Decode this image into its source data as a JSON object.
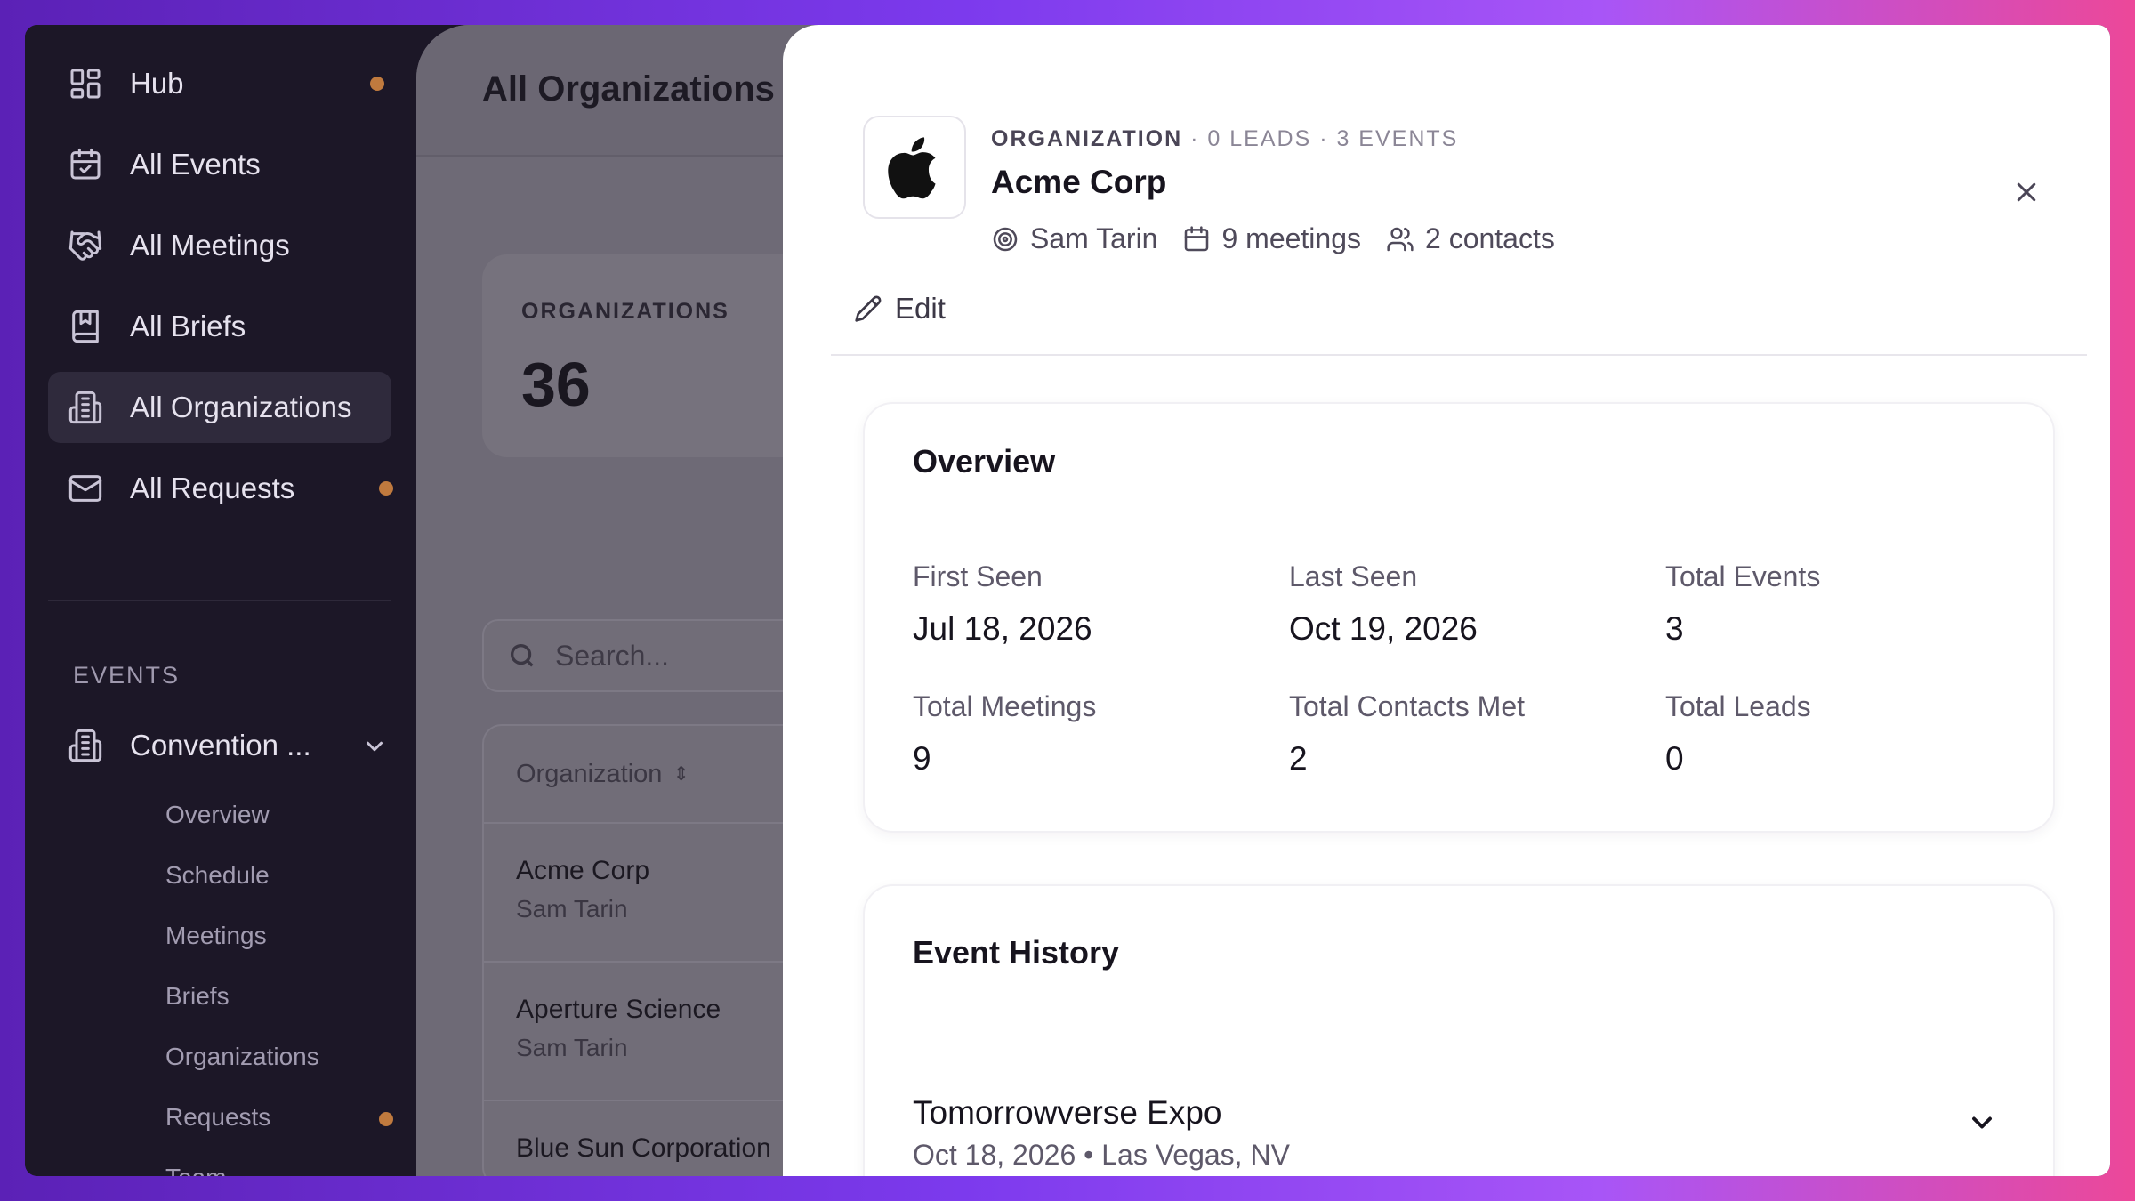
{
  "sidebar": {
    "items": [
      {
        "label": "Hub",
        "icon": "grid-icon",
        "has_dot": true
      },
      {
        "label": "All Events",
        "icon": "calendar-check-icon",
        "has_dot": false
      },
      {
        "label": "All Meetings",
        "icon": "handshake-icon",
        "has_dot": false
      },
      {
        "label": "All Briefs",
        "icon": "bookmark-book-icon",
        "has_dot": false
      },
      {
        "label": "All Organizations",
        "icon": "building-icon",
        "has_dot": false,
        "active": true
      },
      {
        "label": "All Requests",
        "icon": "mail-icon",
        "has_dot": true
      }
    ],
    "events_section": {
      "title": "EVENTS",
      "current_event": "Convention ...",
      "subitems": [
        "Overview",
        "Schedule",
        "Meetings",
        "Briefs",
        "Organizations",
        "Requests",
        "Team"
      ],
      "requests_dot": true
    },
    "dot_color": "#c07a3e"
  },
  "main": {
    "title": "All Organizations",
    "stat": {
      "caption": "ORGANIZATIONS",
      "value": "36"
    },
    "search_placeholder": "Search...",
    "table": {
      "column": "Organization",
      "rows": [
        {
          "name": "Acme Corp",
          "owner": "Sam Tarin"
        },
        {
          "name": "Aperture Science",
          "owner": "Sam Tarin"
        },
        {
          "name": "Blue Sun Corporation",
          "owner": ""
        }
      ]
    }
  },
  "drawer": {
    "eyebrow_type": "ORGANIZATION",
    "eyebrow_counts": "· 0 LEADS · 3 EVENTS",
    "name": "Acme Corp",
    "owner": "Sam Tarin",
    "meetings": "9 meetings",
    "contacts": "2 contacts",
    "edit_label": "Edit",
    "overview": {
      "title": "Overview",
      "stats": [
        {
          "label": "First Seen",
          "value": "Jul 18, 2026"
        },
        {
          "label": "Last Seen",
          "value": "Oct 19, 2026"
        },
        {
          "label": "Total Events",
          "value": "3"
        },
        {
          "label": "Total Meetings",
          "value": "9"
        },
        {
          "label": "Total Contacts Met",
          "value": "2"
        },
        {
          "label": "Total Leads",
          "value": "0"
        }
      ]
    },
    "event_history": {
      "title": "Event History",
      "events": [
        {
          "name": "Tomorrowverse Expo",
          "details": "Oct 18, 2026 • Las Vegas, NV"
        }
      ]
    }
  }
}
